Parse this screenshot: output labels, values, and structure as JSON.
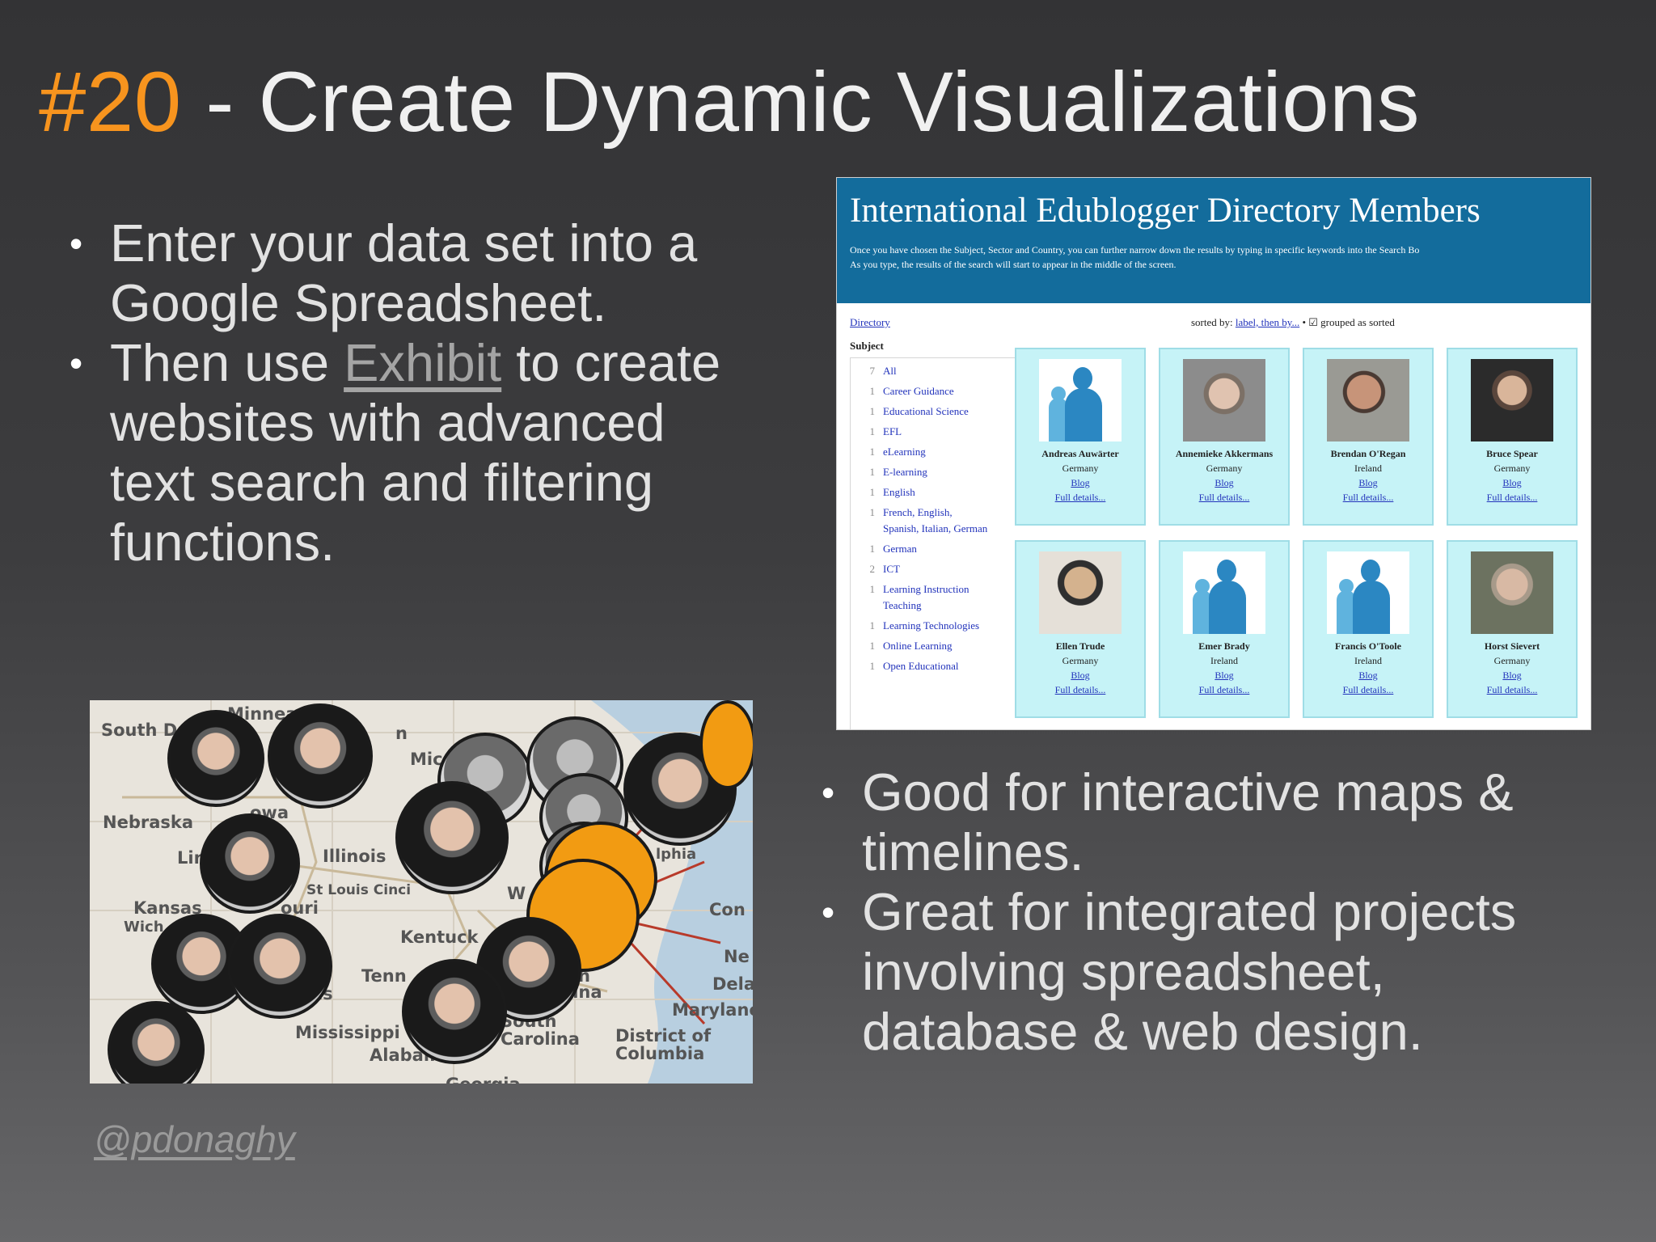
{
  "slide": {
    "title_number": "#20",
    "title_text": " - Create Dynamic Visualizations",
    "left_bullets": {
      "b1": "Enter your data set into a Google Spreadsheet.",
      "b2_before": "Then use ",
      "b2_link": "Exhibit",
      "b2_after": " to create websites with advanced text search and filtering functions."
    },
    "right_bullets": {
      "b1": "Good for interactive maps & timelines.",
      "b2": "Great for integrated projects involving spreadsheet, database & web design."
    },
    "credit": "@pdonaghy",
    "bullet_glyph": "•",
    "colors": {
      "accent": "#f7941e",
      "text": "#e2e2e2",
      "link": "#a4a4a4"
    }
  },
  "directory": {
    "title": "International Edublogger Directory Members",
    "desc_line1": "Once you have chosen the Subject, Sector and Country, you can further narrow down the results by typing in specific keywords into the Search Bo",
    "desc_line2": "As you type, the results of the search will start to appear in the middle of the screen.",
    "directory_link": "Directory",
    "sorted_by": "sorted by: ",
    "sort_keys": "label, then by...",
    "grouped": " • ☑ grouped as sorted",
    "subject_heading": "Subject",
    "subjects": [
      {
        "count": "7",
        "label": "All"
      },
      {
        "count": "1",
        "label": "Career Guidance"
      },
      {
        "count": "1",
        "label": "Educational Science"
      },
      {
        "count": "1",
        "label": "EFL"
      },
      {
        "count": "1",
        "label": "eLearning"
      },
      {
        "count": "1",
        "label": "E-learning"
      },
      {
        "count": "1",
        "label": "English"
      },
      {
        "count": "1",
        "label": "French, English, Spanish, Italian, German"
      },
      {
        "count": "1",
        "label": "German"
      },
      {
        "count": "2",
        "label": "ICT"
      },
      {
        "count": "1",
        "label": "Learning Instruction Teaching"
      },
      {
        "count": "1",
        "label": "Learning Technologies"
      },
      {
        "count": "1",
        "label": "Online Learning"
      },
      {
        "count": "1",
        "label": "Open Educational"
      }
    ],
    "members": [
      {
        "name": "Andreas Auwärter",
        "country": "Germany",
        "blog": "Blog",
        "details": "Full details..."
      },
      {
        "name": "Annemieke Akkermans",
        "country": "Germany",
        "blog": "Blog",
        "details": "Full details..."
      },
      {
        "name": "Brendan O'Regan",
        "country": "Ireland",
        "blog": "Blog",
        "details": "Full details..."
      },
      {
        "name": "Bruce Spear",
        "country": "Germany",
        "blog": "Blog",
        "details": "Full details..."
      },
      {
        "name": "Ellen Trude",
        "country": "Germany",
        "blog": "Blog",
        "details": "Full details..."
      },
      {
        "name": "Emer Brady",
        "country": "Ireland",
        "blog": "Blog",
        "details": "Full details..."
      },
      {
        "name": "Francis O'Toole",
        "country": "Ireland",
        "blog": "Blog",
        "details": "Full details..."
      },
      {
        "name": "Horst Sievert",
        "country": "Germany",
        "blog": "Blog",
        "details": "Full details..."
      }
    ]
  },
  "map": {
    "labels": {
      "south_dakota": "South Dakota",
      "minneapolis": "Minnea",
      "nebraska": "Nebraska",
      "lincoln": "Lin",
      "iowa": "owa",
      "michigan": "Mic",
      "illinois": "Illinois",
      "st_louis": "St Louis Cinci",
      "missouri": "ouri",
      "kansas": "Kansas",
      "wichita": "Wich",
      "kentucky": "Kentuck",
      "tennessee": "Tenn",
      "mississippi": "Mississippi",
      "alabama": "Alabama",
      "georgia": "Georgia",
      "south_carolina": "South Carolina",
      "district_of_columbia": "District of Columbia",
      "maryland": "Marylanc",
      "delaware": "Dela",
      "new_jersey": "Ne",
      "connecticut": "Con",
      "philadelphia": "lphia",
      "washington": "W",
      "carolina_frag": "lina",
      "as_frag": "as",
      "n_frag": "n",
      "h_frag": "h"
    }
  }
}
